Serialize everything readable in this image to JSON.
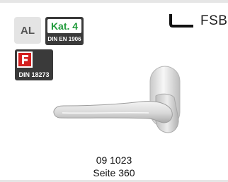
{
  "badges": {
    "material": "AL",
    "category": {
      "label": "Kat. 4",
      "norm": "DIN EN 1906",
      "label_color": "#1f9a3a"
    },
    "fire_protection": {
      "icon": "fire-protection-icon",
      "norm": "DIN 18273",
      "icon_color": "#d42020"
    }
  },
  "brand": {
    "name": "FSB",
    "logo_icon": "fsb-handle-mark-icon"
  },
  "product": {
    "image": "door-lever-handle-image",
    "article_number": "09 1023",
    "catalog_page": "Seite 360"
  }
}
